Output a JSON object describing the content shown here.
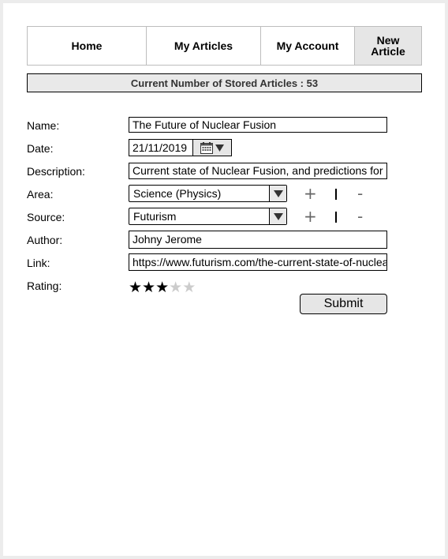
{
  "nav": {
    "tabs": [
      {
        "label": "Home"
      },
      {
        "label": "My Articles"
      },
      {
        "label": "My Account"
      },
      {
        "label_line1": "New",
        "label_line2": "Article",
        "active": true
      }
    ]
  },
  "banner": "Current Number of Stored Articles : 53",
  "form": {
    "name_label": "Name:",
    "name_value": "The Future of Nuclear Fusion",
    "date_label": "Date:",
    "date_value": "21/11/2019",
    "description_label": "Description:",
    "description_value": "Current state of Nuclear Fusion, and predictions for",
    "area_label": "Area:",
    "area_value": "Science (Physics)",
    "source_label": "Source:",
    "source_value": "Futurism",
    "author_label": "Author:",
    "author_value": "Johny Jerome",
    "link_label": "Link:",
    "link_value": "https://www.futurism.com/the-current-state-of-nuclea",
    "rating_label": "Rating:",
    "rating_value": 3,
    "rating_max": 5,
    "add_symbol": "+",
    "remove_symbol": "-",
    "submit_label": "Submit"
  },
  "icons": {
    "calendar": "calendar-icon",
    "dropdown": "dropdown-arrow-icon",
    "star": "star-icon"
  },
  "colors": {
    "active_tab": "#e6e6e6",
    "star_on": "#000000",
    "star_off": "#cccccc"
  }
}
